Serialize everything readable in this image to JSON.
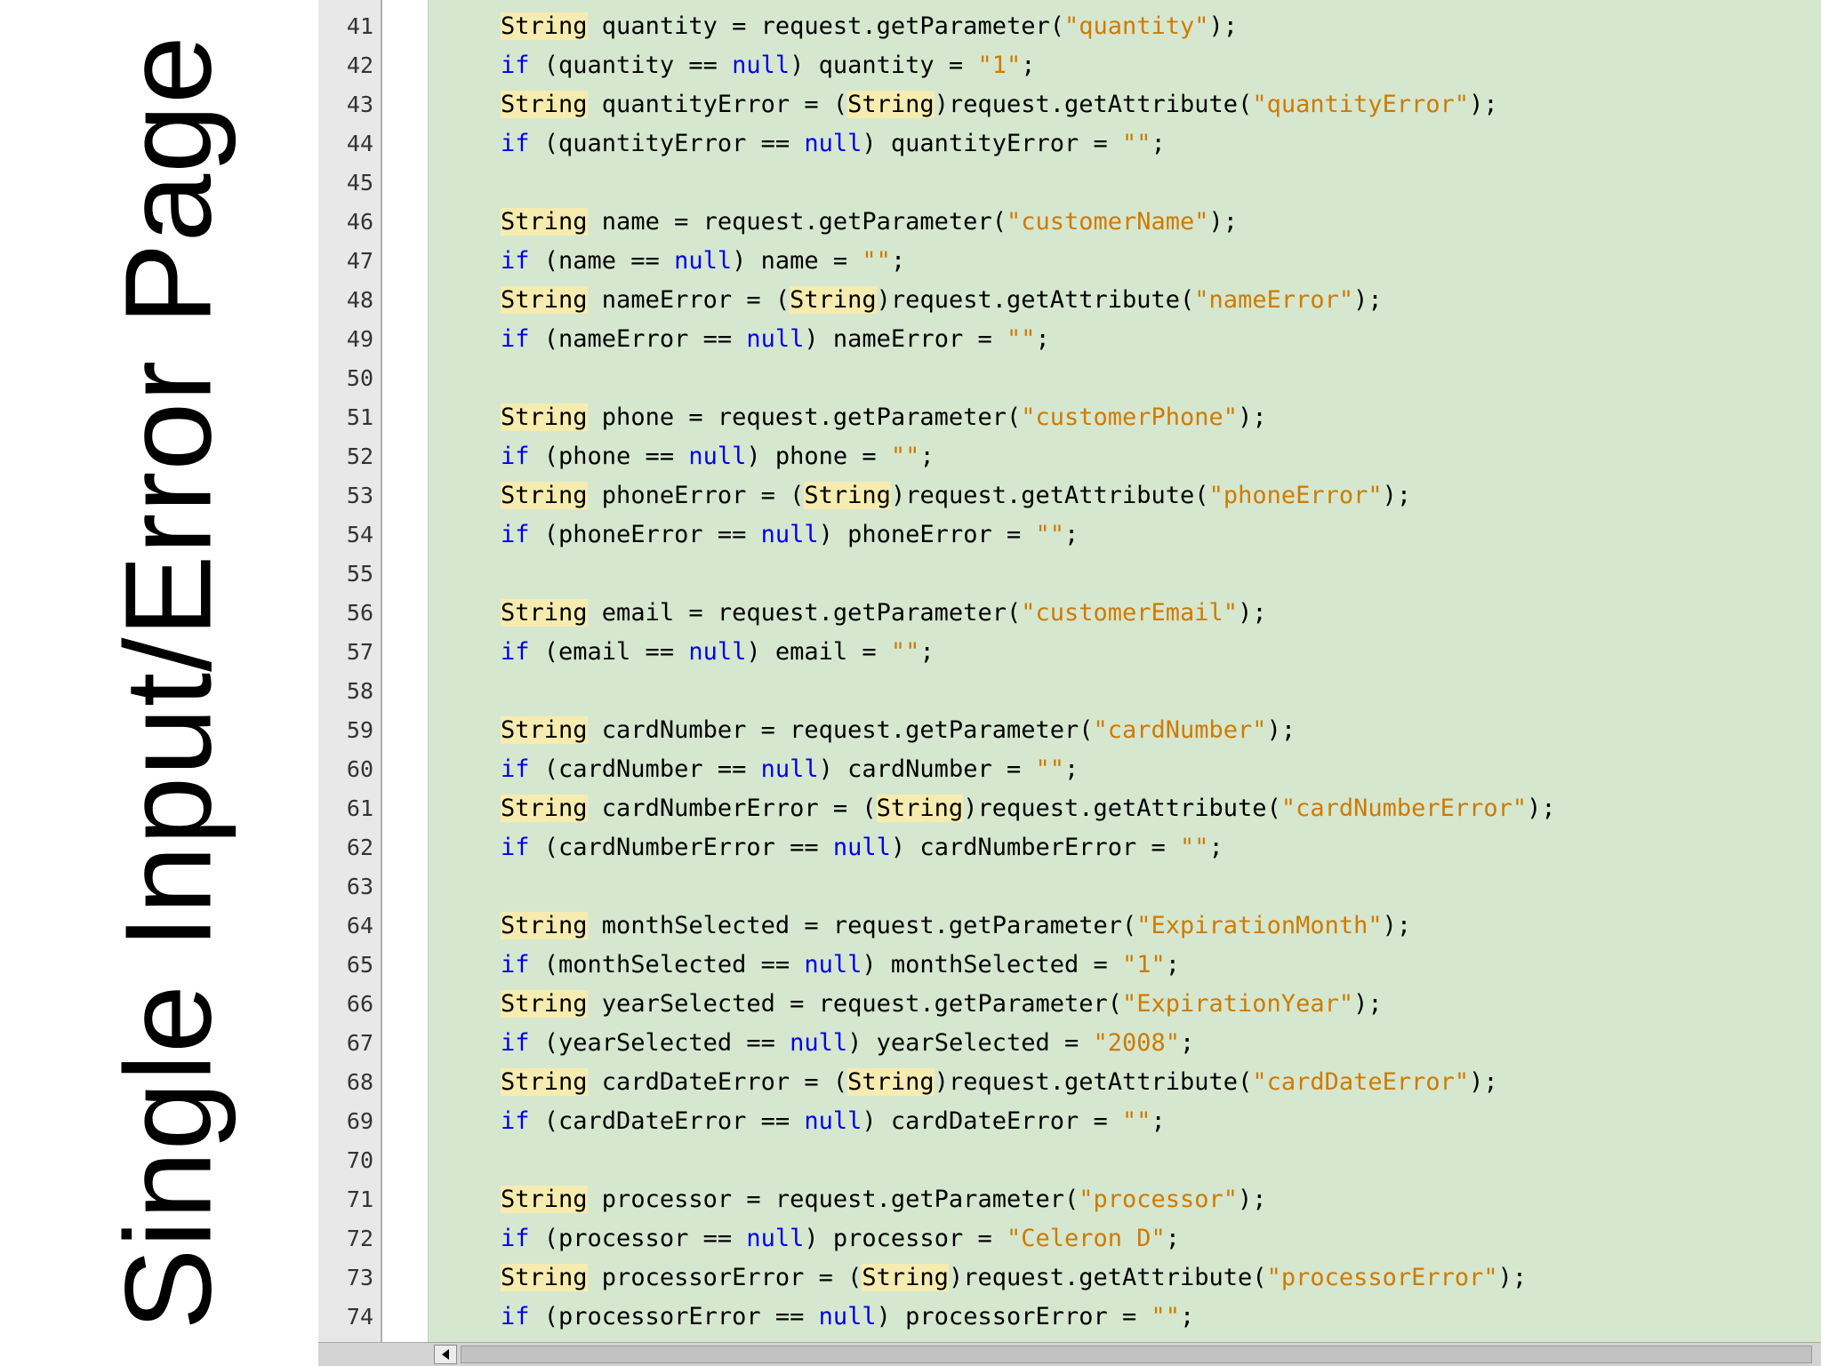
{
  "slide": {
    "title": "Single Input/Error Page"
  },
  "editor": {
    "lines": [
      {
        "num": "41",
        "tokens": [
          {
            "t": "String",
            "c": "type"
          },
          {
            "t": " quantity = request.getParameter(",
            "c": ""
          },
          {
            "t": "\"quantity\"",
            "c": "str"
          },
          {
            "t": ");",
            "c": ""
          }
        ]
      },
      {
        "num": "42",
        "tokens": [
          {
            "t": "if",
            "c": "kw"
          },
          {
            "t": " (quantity == ",
            "c": ""
          },
          {
            "t": "null",
            "c": "kw"
          },
          {
            "t": ") quantity = ",
            "c": ""
          },
          {
            "t": "\"1\"",
            "c": "str"
          },
          {
            "t": ";",
            "c": ""
          }
        ]
      },
      {
        "num": "43",
        "tokens": [
          {
            "t": "String",
            "c": "type"
          },
          {
            "t": " quantityError = (",
            "c": ""
          },
          {
            "t": "String",
            "c": "type"
          },
          {
            "t": ")request.getAttribute(",
            "c": ""
          },
          {
            "t": "\"quantityError\"",
            "c": "str"
          },
          {
            "t": ");",
            "c": ""
          }
        ]
      },
      {
        "num": "44",
        "tokens": [
          {
            "t": "if",
            "c": "kw"
          },
          {
            "t": " (quantityError == ",
            "c": ""
          },
          {
            "t": "null",
            "c": "kw"
          },
          {
            "t": ") quantityError = ",
            "c": ""
          },
          {
            "t": "\"\"",
            "c": "str"
          },
          {
            "t": ";",
            "c": ""
          }
        ]
      },
      {
        "num": "45",
        "tokens": []
      },
      {
        "num": "46",
        "tokens": [
          {
            "t": "String",
            "c": "type"
          },
          {
            "t": " name = request.getParameter(",
            "c": ""
          },
          {
            "t": "\"customerName\"",
            "c": "str"
          },
          {
            "t": ");",
            "c": ""
          }
        ]
      },
      {
        "num": "47",
        "tokens": [
          {
            "t": "if",
            "c": "kw"
          },
          {
            "t": " (name == ",
            "c": ""
          },
          {
            "t": "null",
            "c": "kw"
          },
          {
            "t": ") name = ",
            "c": ""
          },
          {
            "t": "\"\"",
            "c": "str"
          },
          {
            "t": ";",
            "c": ""
          }
        ]
      },
      {
        "num": "48",
        "tokens": [
          {
            "t": "String",
            "c": "type"
          },
          {
            "t": " nameError = (",
            "c": ""
          },
          {
            "t": "String",
            "c": "type"
          },
          {
            "t": ")request.getAttribute(",
            "c": ""
          },
          {
            "t": "\"nameError\"",
            "c": "str"
          },
          {
            "t": ");",
            "c": ""
          }
        ]
      },
      {
        "num": "49",
        "tokens": [
          {
            "t": "if",
            "c": "kw"
          },
          {
            "t": " (nameError == ",
            "c": ""
          },
          {
            "t": "null",
            "c": "kw"
          },
          {
            "t": ") nameError = ",
            "c": ""
          },
          {
            "t": "\"\"",
            "c": "str"
          },
          {
            "t": ";",
            "c": ""
          }
        ]
      },
      {
        "num": "50",
        "tokens": []
      },
      {
        "num": "51",
        "tokens": [
          {
            "t": "String",
            "c": "type"
          },
          {
            "t": " phone = request.getParameter(",
            "c": ""
          },
          {
            "t": "\"customerPhone\"",
            "c": "str"
          },
          {
            "t": ");",
            "c": ""
          }
        ]
      },
      {
        "num": "52",
        "tokens": [
          {
            "t": "if",
            "c": "kw"
          },
          {
            "t": " (phone == ",
            "c": ""
          },
          {
            "t": "null",
            "c": "kw"
          },
          {
            "t": ") phone = ",
            "c": ""
          },
          {
            "t": "\"\"",
            "c": "str"
          },
          {
            "t": ";",
            "c": ""
          }
        ]
      },
      {
        "num": "53",
        "tokens": [
          {
            "t": "String",
            "c": "type"
          },
          {
            "t": " phoneError = (",
            "c": ""
          },
          {
            "t": "String",
            "c": "type"
          },
          {
            "t": ")request.getAttribute(",
            "c": ""
          },
          {
            "t": "\"phoneError\"",
            "c": "str"
          },
          {
            "t": ");",
            "c": ""
          }
        ]
      },
      {
        "num": "54",
        "tokens": [
          {
            "t": "if",
            "c": "kw"
          },
          {
            "t": " (phoneError == ",
            "c": ""
          },
          {
            "t": "null",
            "c": "kw"
          },
          {
            "t": ") phoneError = ",
            "c": ""
          },
          {
            "t": "\"\"",
            "c": "str"
          },
          {
            "t": ";",
            "c": ""
          }
        ]
      },
      {
        "num": "55",
        "tokens": []
      },
      {
        "num": "56",
        "tokens": [
          {
            "t": "String",
            "c": "type"
          },
          {
            "t": " email = request.getParameter(",
            "c": ""
          },
          {
            "t": "\"customerEmail\"",
            "c": "str"
          },
          {
            "t": ");",
            "c": ""
          }
        ]
      },
      {
        "num": "57",
        "tokens": [
          {
            "t": "if",
            "c": "kw"
          },
          {
            "t": " (email == ",
            "c": ""
          },
          {
            "t": "null",
            "c": "kw"
          },
          {
            "t": ") email = ",
            "c": ""
          },
          {
            "t": "\"\"",
            "c": "str"
          },
          {
            "t": ";",
            "c": ""
          }
        ]
      },
      {
        "num": "58",
        "tokens": []
      },
      {
        "num": "59",
        "tokens": [
          {
            "t": "String",
            "c": "type"
          },
          {
            "t": " cardNumber = request.getParameter(",
            "c": ""
          },
          {
            "t": "\"cardNumber\"",
            "c": "str"
          },
          {
            "t": ");",
            "c": ""
          }
        ]
      },
      {
        "num": "60",
        "tokens": [
          {
            "t": "if",
            "c": "kw"
          },
          {
            "t": " (cardNumber == ",
            "c": ""
          },
          {
            "t": "null",
            "c": "kw"
          },
          {
            "t": ") cardNumber = ",
            "c": ""
          },
          {
            "t": "\"\"",
            "c": "str"
          },
          {
            "t": ";",
            "c": ""
          }
        ]
      },
      {
        "num": "61",
        "tokens": [
          {
            "t": "String",
            "c": "type"
          },
          {
            "t": " cardNumberError = (",
            "c": ""
          },
          {
            "t": "String",
            "c": "type"
          },
          {
            "t": ")request.getAttribute(",
            "c": ""
          },
          {
            "t": "\"cardNumberError\"",
            "c": "str"
          },
          {
            "t": ");",
            "c": ""
          }
        ]
      },
      {
        "num": "62",
        "tokens": [
          {
            "t": "if",
            "c": "kw"
          },
          {
            "t": " (cardNumberError == ",
            "c": ""
          },
          {
            "t": "null",
            "c": "kw"
          },
          {
            "t": ") cardNumberError = ",
            "c": ""
          },
          {
            "t": "\"\"",
            "c": "str"
          },
          {
            "t": ";",
            "c": ""
          }
        ]
      },
      {
        "num": "63",
        "tokens": []
      },
      {
        "num": "64",
        "tokens": [
          {
            "t": "String",
            "c": "type"
          },
          {
            "t": " monthSelected = request.getParameter(",
            "c": ""
          },
          {
            "t": "\"ExpirationMonth\"",
            "c": "str"
          },
          {
            "t": ");",
            "c": ""
          }
        ]
      },
      {
        "num": "65",
        "tokens": [
          {
            "t": "if",
            "c": "kw"
          },
          {
            "t": " (monthSelected == ",
            "c": ""
          },
          {
            "t": "null",
            "c": "kw"
          },
          {
            "t": ") monthSelected = ",
            "c": ""
          },
          {
            "t": "\"1\"",
            "c": "str"
          },
          {
            "t": ";",
            "c": ""
          }
        ]
      },
      {
        "num": "66",
        "tokens": [
          {
            "t": "String",
            "c": "type"
          },
          {
            "t": " yearSelected = request.getParameter(",
            "c": ""
          },
          {
            "t": "\"ExpirationYear\"",
            "c": "str"
          },
          {
            "t": ");",
            "c": ""
          }
        ]
      },
      {
        "num": "67",
        "tokens": [
          {
            "t": "if",
            "c": "kw"
          },
          {
            "t": " (yearSelected == ",
            "c": ""
          },
          {
            "t": "null",
            "c": "kw"
          },
          {
            "t": ") yearSelected = ",
            "c": ""
          },
          {
            "t": "\"2008\"",
            "c": "str"
          },
          {
            "t": ";",
            "c": ""
          }
        ]
      },
      {
        "num": "68",
        "tokens": [
          {
            "t": "String",
            "c": "type"
          },
          {
            "t": " cardDateError = (",
            "c": ""
          },
          {
            "t": "String",
            "c": "type"
          },
          {
            "t": ")request.getAttribute(",
            "c": ""
          },
          {
            "t": "\"cardDateError\"",
            "c": "str"
          },
          {
            "t": ");",
            "c": ""
          }
        ]
      },
      {
        "num": "69",
        "tokens": [
          {
            "t": "if",
            "c": "kw"
          },
          {
            "t": " (cardDateError == ",
            "c": ""
          },
          {
            "t": "null",
            "c": "kw"
          },
          {
            "t": ") cardDateError = ",
            "c": ""
          },
          {
            "t": "\"\"",
            "c": "str"
          },
          {
            "t": ";",
            "c": ""
          }
        ]
      },
      {
        "num": "70",
        "tokens": []
      },
      {
        "num": "71",
        "tokens": [
          {
            "t": "String",
            "c": "type"
          },
          {
            "t": " processor = request.getParameter(",
            "c": ""
          },
          {
            "t": "\"processor\"",
            "c": "str"
          },
          {
            "t": ");",
            "c": ""
          }
        ]
      },
      {
        "num": "72",
        "tokens": [
          {
            "t": "if",
            "c": "kw"
          },
          {
            "t": " (processor == ",
            "c": ""
          },
          {
            "t": "null",
            "c": "kw"
          },
          {
            "t": ") processor = ",
            "c": ""
          },
          {
            "t": "\"Celeron D\"",
            "c": "str"
          },
          {
            "t": ";",
            "c": ""
          }
        ]
      },
      {
        "num": "73",
        "tokens": [
          {
            "t": "String",
            "c": "type"
          },
          {
            "t": " processorError = (",
            "c": ""
          },
          {
            "t": "String",
            "c": "type"
          },
          {
            "t": ")request.getAttribute(",
            "c": ""
          },
          {
            "t": "\"processorError\"",
            "c": "str"
          },
          {
            "t": ");",
            "c": ""
          }
        ]
      },
      {
        "num": "74",
        "tokens": [
          {
            "t": "if",
            "c": "kw"
          },
          {
            "t": " (processorError == ",
            "c": ""
          },
          {
            "t": "null",
            "c": "kw"
          },
          {
            "t": ") processorError = ",
            "c": ""
          },
          {
            "t": "\"\"",
            "c": "str"
          },
          {
            "t": ";",
            "c": ""
          }
        ]
      }
    ]
  },
  "icons": {
    "scroll_left": "triangle-left-icon"
  },
  "colors": {
    "editor_background": "#d6e7d0",
    "keyword": "#0000e6",
    "string_literal": "#ce7b00",
    "type_highlight": "#f6ecb0"
  }
}
